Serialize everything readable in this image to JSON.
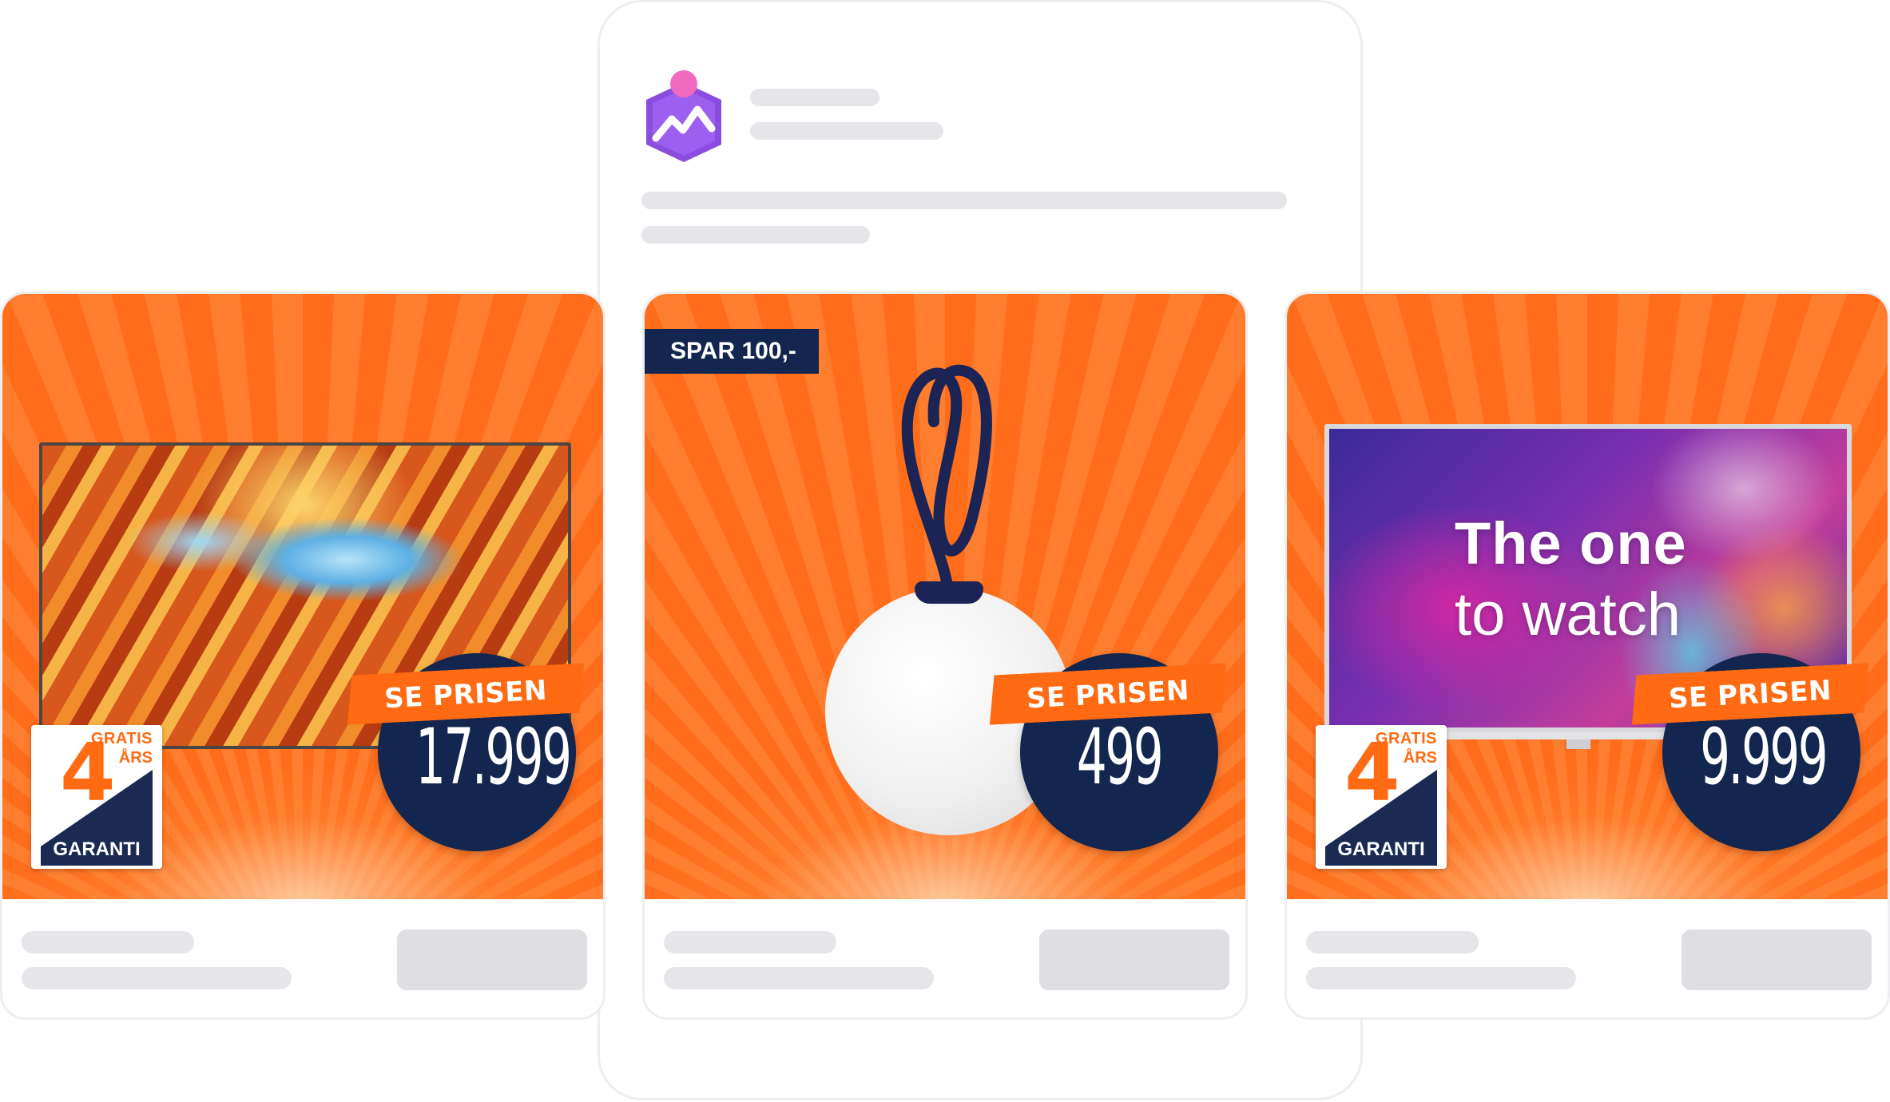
{
  "colors": {
    "accent_orange": "#ff6a13",
    "navy": "#13264f",
    "skeleton": "#e6e6ea",
    "brand_purple": "#8b4de0",
    "brand_pink": "#f06ac0"
  },
  "brand": {
    "icon": "brand-logo-icon"
  },
  "cards": [
    {
      "product_icon": "television-icon",
      "warranty": {
        "gratis": "GRATIS",
        "years_label": "ÅRS",
        "number": "4",
        "garanti": "GARANTI"
      },
      "price_label": "SE PRISEN",
      "price": "17.999"
    },
    {
      "product_icon": "lamp-icon",
      "save_tag": "SPAR 100,-",
      "price_label": "SE PRISEN",
      "price": "499"
    },
    {
      "product_icon": "television-icon",
      "screen_text_1": "The one",
      "screen_text_2": "to watch",
      "warranty": {
        "gratis": "GRATIS",
        "years_label": "ÅRS",
        "number": "4",
        "garanti": "GARANTI"
      },
      "price_label": "SE PRISEN",
      "price": "9.999"
    }
  ]
}
